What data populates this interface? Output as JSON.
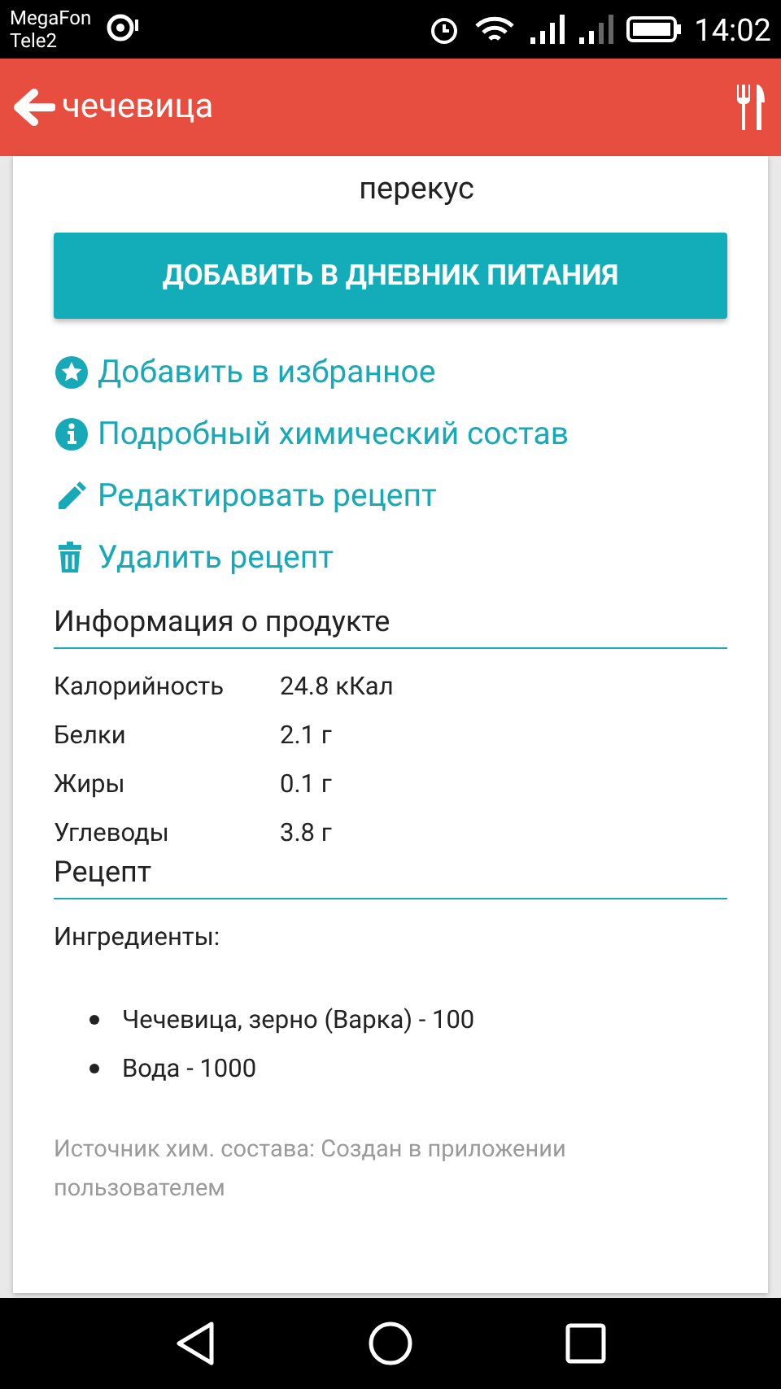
{
  "status_bar": {
    "carriers": [
      "MegaFon",
      "Tele2"
    ],
    "time": "14:02"
  },
  "app_bar": {
    "title": "чечевица"
  },
  "meal": "перекус",
  "add_button": "ДОБАВИТЬ В ДНЕВНИК ПИТАНИЯ",
  "actions": [
    {
      "kind": "star",
      "label": "Добавить в избранное"
    },
    {
      "kind": "info",
      "label": "Подробный химический состав"
    },
    {
      "kind": "edit",
      "label": "Редактировать рецепт"
    },
    {
      "kind": "delete",
      "label": "Удалить рецепт"
    }
  ],
  "product_info": {
    "heading": "Информация о продукте",
    "rows": [
      {
        "name": "Калорийность",
        "value": "24.8 кКал"
      },
      {
        "name": "Белки",
        "value": "2.1 г"
      },
      {
        "name": "Жиры",
        "value": "0.1 г"
      },
      {
        "name": "Углеводы",
        "value": "3.8 г"
      }
    ]
  },
  "recipe": {
    "heading": "Рецепт",
    "ingredients_label": "Ингредиенты:",
    "ingredients": [
      "Чечевица, зерно (Варка) - 100",
      "Вода - 1000"
    ]
  },
  "source": "Источник хим. состава: Создан в приложении пользователем"
}
